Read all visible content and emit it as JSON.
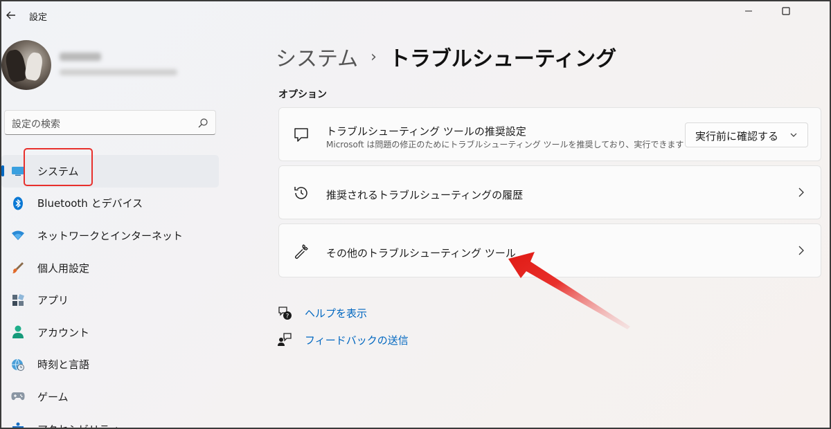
{
  "window": {
    "title": "設定"
  },
  "search": {
    "placeholder": "設定の検索"
  },
  "sidebar": {
    "items": [
      {
        "label": "システム",
        "icon": "monitor-icon",
        "active": true
      },
      {
        "label": "Bluetooth とデバイス",
        "icon": "bluetooth-icon"
      },
      {
        "label": "ネットワークとインターネット",
        "icon": "wifi-icon"
      },
      {
        "label": "個人用設定",
        "icon": "brush-icon"
      },
      {
        "label": "アプリ",
        "icon": "apps-icon"
      },
      {
        "label": "アカウント",
        "icon": "person-icon"
      },
      {
        "label": "時刻と言語",
        "icon": "globe-clock-icon"
      },
      {
        "label": "ゲーム",
        "icon": "gamepad-icon"
      },
      {
        "label": "アクセシビリティ",
        "icon": "accessibility-icon"
      }
    ]
  },
  "breadcrumb": {
    "parent": "システム",
    "separator": "›",
    "current": "トラブルシューティング"
  },
  "options": {
    "section_title": "オプション",
    "cards": [
      {
        "title": "トラブルシューティング ツールの推奨設定",
        "description": "Microsoft は問題の修正のためにトラブルシューティング ツールを推奨しており、実行できます",
        "dropdown_value": "実行前に確認する",
        "icon": "chat-bubble-icon"
      },
      {
        "title": "推奨されるトラブルシューティングの履歴",
        "icon": "history-icon"
      },
      {
        "title": "その他のトラブルシューティング ツール",
        "icon": "wrench-icon"
      }
    ]
  },
  "links": [
    {
      "label": "ヘルプを表示",
      "icon": "help-icon"
    },
    {
      "label": "フィードバックの送信",
      "icon": "feedback-icon"
    }
  ],
  "colors": {
    "accent": "#0067c0",
    "annotation_red": "#e8302c"
  }
}
